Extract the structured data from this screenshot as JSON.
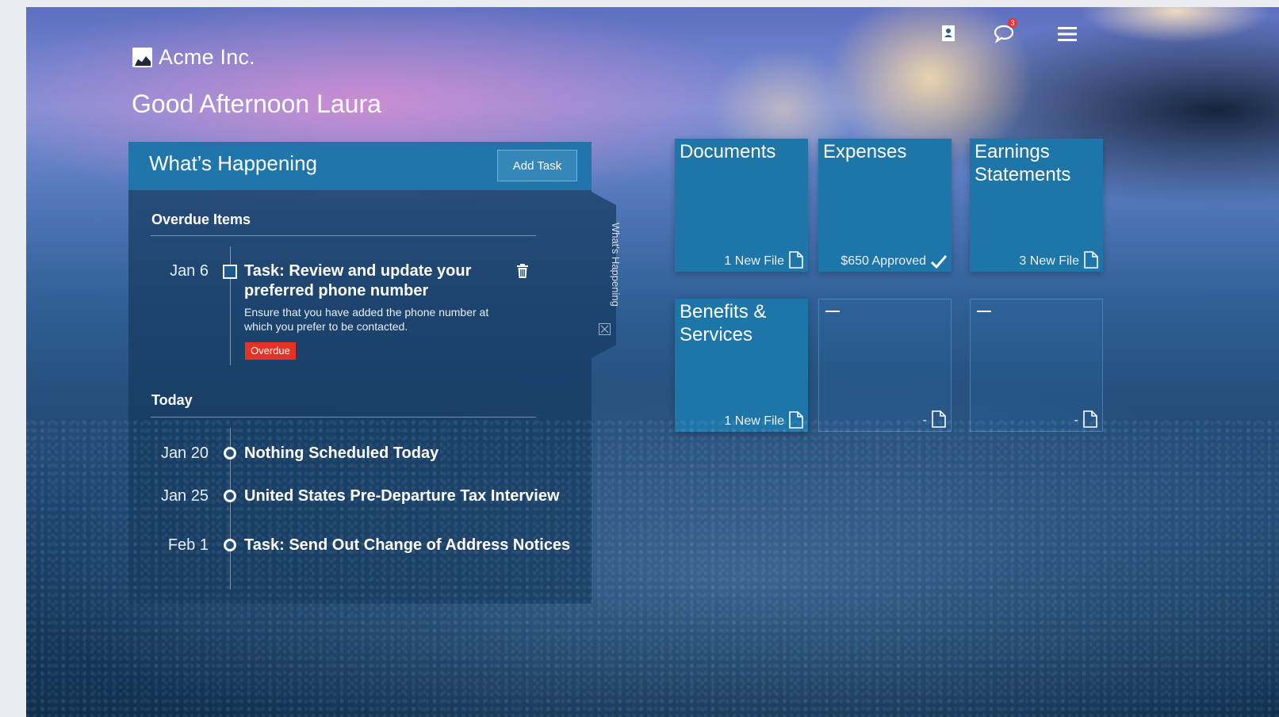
{
  "brand": {
    "name": "Acme Inc.",
    "logo_icon": "brand-logo-icon"
  },
  "greeting": "Good Afternoon Laura",
  "top_nav": {
    "icons": [
      "contact-card-icon",
      "chat-bubble-icon",
      "hamburger-menu-icon"
    ],
    "chat_badge": "3"
  },
  "panel": {
    "title": "What’s Happening",
    "add_task_label": "Add Task",
    "side_tab_label": "What's Happening",
    "overdue": {
      "title": "Overdue Items",
      "items": [
        {
          "date": "Jan 6",
          "title_line1": "Task: Review and update your",
          "title_line2": "preferred phone number",
          "description_line1": "Ensure that you have added the phone number at",
          "description_line2": "which you prefer to be contacted.",
          "status": "Overdue"
        }
      ]
    },
    "today": {
      "title": "Today",
      "items": [
        {
          "date": "Jan 20",
          "title": "Nothing Scheduled Today"
        },
        {
          "date": "Jan 25",
          "title": "United States Pre-Departure Tax Interview"
        },
        {
          "date": "Feb 1",
          "title": "Task: Send Out Change of Address Notices"
        }
      ]
    }
  },
  "tiles": [
    {
      "title_line1": "Documents",
      "title_line2": "",
      "footer": "1 New File",
      "icon": "file-icon"
    },
    {
      "title_line1": "Expenses",
      "title_line2": "",
      "footer": "$650 Approved",
      "icon": "checkmark-icon"
    },
    {
      "title_line1": "Earnings",
      "title_line2": "Statements",
      "footer": "3 New File",
      "icon": "file-icon"
    },
    {
      "title_line1": "Benefits &",
      "title_line2": "Services",
      "footer": "1 New File",
      "icon": "file-icon"
    },
    {
      "title_line1": "",
      "title_line2": "",
      "footer": "-",
      "icon": "file-icon"
    },
    {
      "title_line1": "",
      "title_line2": "",
      "footer": "-",
      "icon": "file-icon"
    }
  ],
  "colors": {
    "header_blue": "#2076aa",
    "tile_blue": "#1e75a8",
    "overdue_red": "#e73223"
  }
}
